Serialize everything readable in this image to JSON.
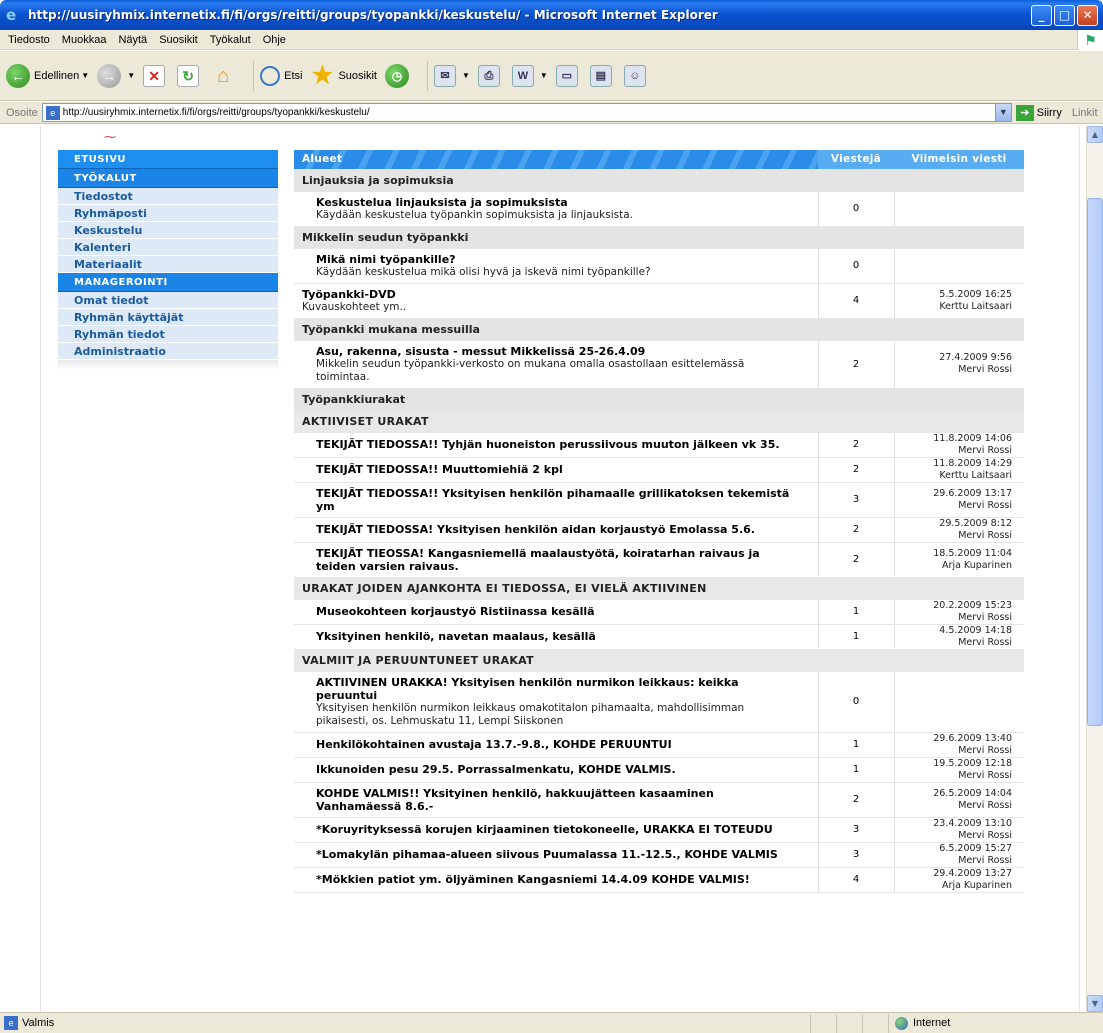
{
  "window": {
    "title": "http://uusiryhmix.internetix.fi/fi/orgs/reitti/groups/tyopankki/keskustelu/ - Microsoft Internet Explorer",
    "minimize": "_",
    "maximize": "□",
    "close": "✕"
  },
  "menu": [
    "Tiedosto",
    "Muokkaa",
    "Näytä",
    "Suosikit",
    "Työkalut",
    "Ohje"
  ],
  "toolbar": {
    "back_label": "Edellinen",
    "search_label": "Etsi",
    "favorites_label": "Suosikit"
  },
  "address": {
    "label": "Osoite",
    "url": "http://uusiryhmix.internetix.fi/fi/orgs/reitti/groups/tyopankki/keskustelu/",
    "go_label": "Siirry",
    "links_label": "Linkit"
  },
  "sidebar": {
    "etusivu": "ETUSIVU",
    "tyokalut": "TYÖKALUT",
    "tools": [
      "Tiedostot",
      "Ryhmäposti",
      "Keskustelu",
      "Kalenteri",
      "Materiaalit"
    ],
    "managerointi": "MANAGEROINTI",
    "manage": [
      "Omat tiedot",
      "Ryhmän käyttäjät",
      "Ryhmän tiedot",
      "Administraatio"
    ]
  },
  "forum": {
    "headers": {
      "area": "Alueet",
      "count": "Viestejä",
      "last": "Viimeisin viesti"
    },
    "cat1": "Linjauksia ja sopimuksia",
    "r1": {
      "title": "Keskustelua linjauksista ja sopimuksista",
      "desc": "Käydään keskustelua työpankin sopimuksista ja linjauksista.",
      "count": "0",
      "date": "",
      "user": ""
    },
    "cat2": "Mikkelin seudun työpankki",
    "r2": {
      "title": "Mikä nimi työpankille?",
      "desc": "Käydään keskustelua mikä olisi hyvä ja iskevä nimi työpankille?",
      "count": "0",
      "date": "",
      "user": ""
    },
    "r3": {
      "title": "Työpankki-DVD",
      "desc": "Kuvauskohteet ym..",
      "count": "4",
      "date": "5.5.2009 16:25",
      "user": "Kerttu Laitsaari"
    },
    "cat3": "Työpankki mukana messuilla",
    "r4": {
      "title": "Asu, rakenna, sisusta - messut Mikkelissä 25-26.4.09",
      "desc": "Mikkelin seudun työpankki-verkosto on mukana omalla osastollaan esittelemässä toimintaa.",
      "count": "2",
      "date": "27.4.2009 9:56",
      "user": "Mervi Rossi"
    },
    "cat4": "Työpankkiurakat",
    "sub1": "AKTIIVISET URAKAT",
    "r5": {
      "title": "TEKIJÄT TIEDOSSA!! Tyhjän huoneiston perussiivous muuton jälkeen vk 35.",
      "count": "2",
      "date": "11.8.2009 14:06",
      "user": "Mervi Rossi"
    },
    "r6": {
      "title": "TEKIJÄT TIEDOSSA!! Muuttomiehiä 2 kpl",
      "count": "2",
      "date": "11.8.2009 14:29",
      "user": "Kerttu Laitsaari"
    },
    "r7": {
      "title": "TEKIJÄT TIEDOSSA!! Yksityisen henkilön pihamaalle grillikatoksen tekemistä ym",
      "count": "3",
      "date": "29.6.2009 13:17",
      "user": "Mervi Rossi"
    },
    "r8": {
      "title": "TEKIJÄT TIEDOSSA! Yksityisen henkilön aidan korjaustyö Emolassa 5.6.",
      "count": "2",
      "date": "29.5.2009 8:12",
      "user": "Mervi Rossi"
    },
    "r9": {
      "title": "TEKIJÄT TIEOSSA! Kangasniemellä maalaustyötä, koiratarhan raivaus ja teiden varsien raivaus.",
      "count": "2",
      "date": "18.5.2009 11:04",
      "user": "Arja Kuparinen"
    },
    "sub2": "URAKAT JOIDEN AJANKOHTA EI TIEDOSSA, EI VIELÄ AKTIIVINEN",
    "r10": {
      "title": "Museokohteen korjaustyö Ristiinassa kesällä",
      "count": "1",
      "date": "20.2.2009 15:23",
      "user": "Mervi Rossi"
    },
    "r11": {
      "title": "Yksityinen henkilö, navetan maalaus, kesällä",
      "count": "1",
      "date": "4.5.2009 14:18",
      "user": "Mervi Rossi"
    },
    "sub3": "VALMIIT JA PERUUNTUNEET URAKAT",
    "r12": {
      "title": "AKTIIVINEN URAKKA! Yksityisen henkilön nurmikon leikkaus: keikka peruuntui",
      "desc": "Yksityisen henkilön nurmikon leikkaus omakotitalon pihamaalta, mahdollisimman pikaisesti, os. Lehmuskatu 11, Lempi Siiskonen",
      "count": "0",
      "date": "",
      "user": ""
    },
    "r13": {
      "title": "Henkilökohtainen avustaja 13.7.-9.8., KOHDE PERUUNTUI",
      "count": "1",
      "date": "29.6.2009 13:40",
      "user": "Mervi Rossi"
    },
    "r14": {
      "title": "Ikkunoiden pesu 29.5. Porrassalmenkatu, KOHDE VALMIS.",
      "count": "1",
      "date": "19.5.2009 12:18",
      "user": "Mervi Rossi"
    },
    "r15": {
      "title": "KOHDE VALMIS!! Yksityinen henkilö, hakkuujätteen kasaaminen Vanhamäessä 8.6.-",
      "count": "2",
      "date": "26.5.2009 14:04",
      "user": "Mervi Rossi"
    },
    "r16": {
      "title": "*Koruyrityksessä korujen kirjaaminen tietokoneelle, URAKKA EI TOTEUDU",
      "count": "3",
      "date": "23.4.2009 13:10",
      "user": "Mervi Rossi"
    },
    "r17": {
      "title": "*Lomakylän pihamaa-alueen siivous Puumalassa 11.-12.5., KOHDE VALMIS",
      "count": "3",
      "date": "6.5.2009 15:27",
      "user": "Mervi Rossi"
    },
    "r18": {
      "title": "*Mökkien patiot ym. öljyäminen Kangasniemi 14.4.09 KOHDE VALMIS!",
      "count": "4",
      "date": "29.4.2009 13:27",
      "user": "Arja Kuparinen"
    }
  },
  "status": {
    "text": "Valmis",
    "zone": "Internet"
  }
}
